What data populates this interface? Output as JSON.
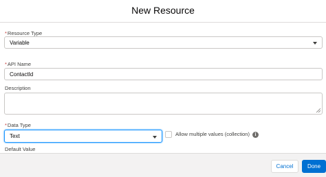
{
  "dialog": {
    "title": "New Resource"
  },
  "form": {
    "required_marker": "*",
    "resource_type": {
      "label": "Resource Type",
      "value": "Variable"
    },
    "api_name": {
      "label": "API Name",
      "value": "ContactId"
    },
    "description": {
      "label": "Description",
      "value": ""
    },
    "data_type": {
      "label": "Data Type",
      "value": "Text"
    },
    "allow_multiple": {
      "label": "Allow multiple values (collection)",
      "checked": false
    },
    "default_value": {
      "label": "Default Value"
    }
  },
  "footer": {
    "cancel_label": "Cancel",
    "done_label": "Done"
  },
  "colors": {
    "accent": "#0070d2",
    "required": "#c23934",
    "focus_border": "#1b96ff"
  },
  "icons": {
    "info": "info-icon",
    "caret": "chevron-down-icon"
  }
}
